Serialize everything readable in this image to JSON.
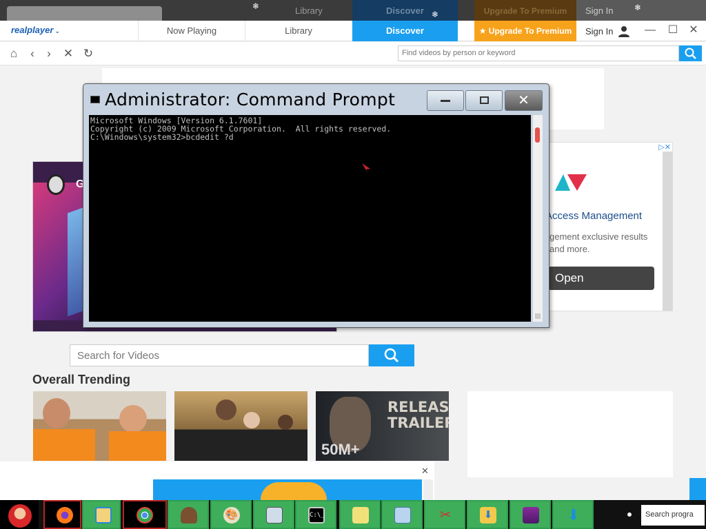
{
  "realplayer": {
    "logo": "realplayer",
    "tabs": [
      "Now Playing",
      "Library",
      "Discover"
    ],
    "premium": "★ Upgrade To Premium",
    "sign_in": "Sign In",
    "search_placeholder": "Find videos by person or keyword"
  },
  "ghost": {
    "library": "Library",
    "discover": "Discover",
    "premium": "Upgrade To Premium",
    "sign_in": "Sign In"
  },
  "cmd": {
    "title": "Administrator: Command Prompt",
    "lines": [
      "Microsoft Windows [Version 6.1.7601]",
      "Copyright (c) 2009 Microsoft Corporation.  All rights reserved.",
      "",
      "C:\\Windows\\system32>bcdedit ?d"
    ]
  },
  "hero": {
    "label": "G"
  },
  "ad": {
    "title": "Access Management",
    "subtitle": "gement exclusive results and more.",
    "button": "Open"
  },
  "video_search": {
    "placeholder": "Search for Videos"
  },
  "trending": {
    "title": "Overall Trending",
    "thumb3_text": "RELEASE TRAILER",
    "thumb3_num": "50M+"
  },
  "taskbar": {
    "items": [
      "santa",
      "firefox",
      "files",
      "chrome",
      "wizard",
      "paint",
      "calculator",
      "cmd",
      "notes",
      "document",
      "scissors",
      "downloads-folder",
      "winrar",
      "download-arrow"
    ],
    "tray_text": "Search progra"
  }
}
